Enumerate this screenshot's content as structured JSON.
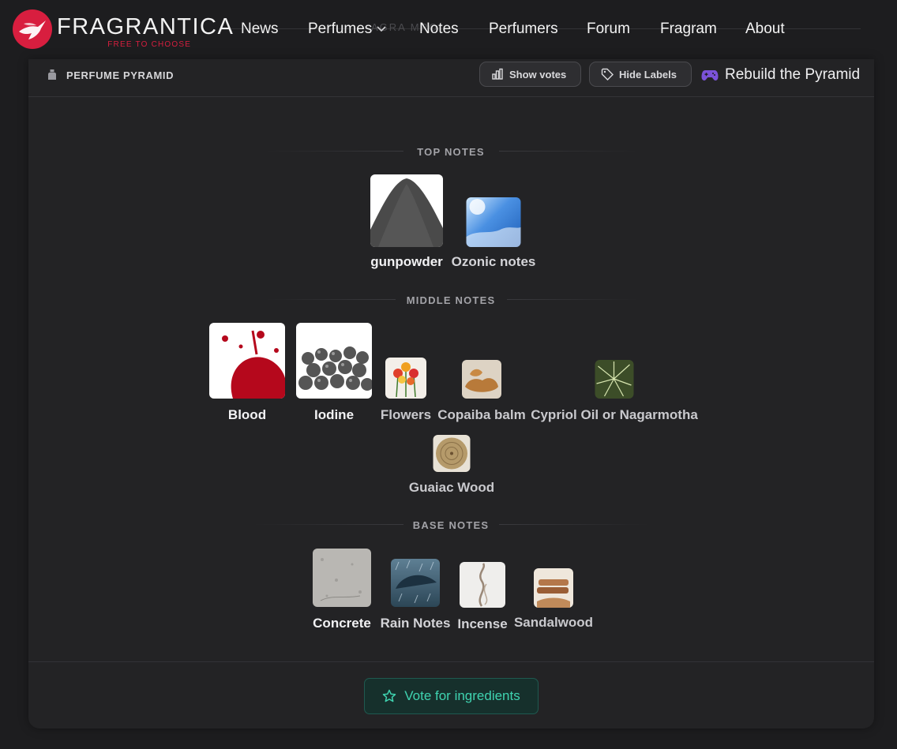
{
  "brand": {
    "name": "FRAGRANTICA",
    "tagline": "FREE TO CHOOSE",
    "accent": "#d81e3f"
  },
  "background_text": "AGRA    MPO",
  "nav": {
    "items": [
      "News",
      "Perfumes",
      "Notes",
      "Perfumers",
      "Forum",
      "Fragram",
      "About"
    ]
  },
  "pyramid": {
    "title": "PERFUME PYRAMID",
    "show_votes": "Show votes",
    "hide_labels": "Hide Labels",
    "rebuild": "Rebuild the Pyramid",
    "top_label": "TOP NOTES",
    "middle_label": "MIDDLE NOTES",
    "base_label": "BASE NOTES",
    "top": [
      "gunpowder",
      "Ozonic notes"
    ],
    "middle": [
      "Blood",
      "Iodine",
      "Flowers",
      "Copaiba balm",
      "Cypriol Oil or Nagarmotha",
      "Guaiac Wood"
    ],
    "base": [
      "Concrete",
      "Rain Notes",
      "Incense",
      "Sandalwood"
    ],
    "vote_button": "Vote for ingredients",
    "vote_color": "#3fd3b0"
  }
}
